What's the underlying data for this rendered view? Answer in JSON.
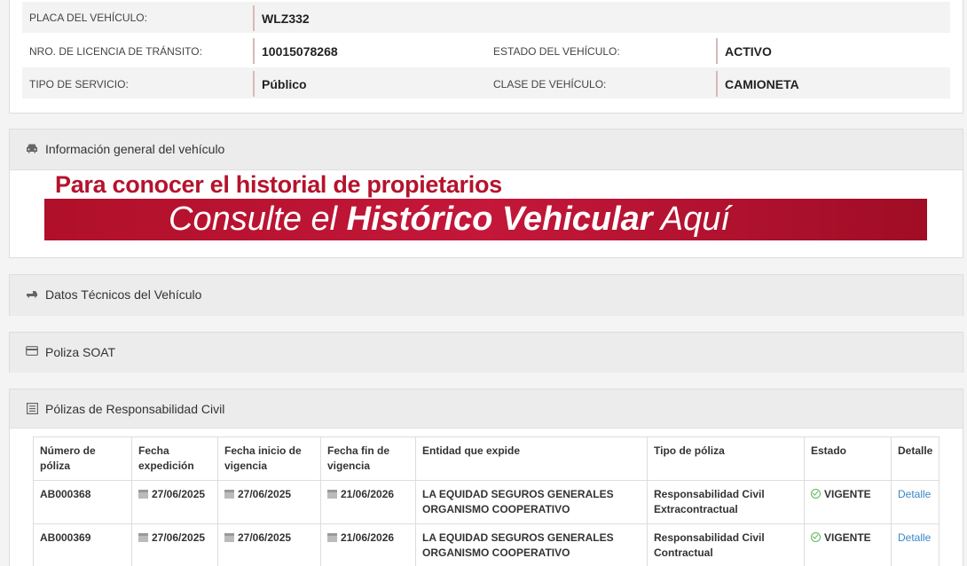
{
  "vehicle": {
    "plate_label": "PLACA DEL VEHÍCULO:",
    "plate_value": "WLZ332",
    "license_label": "NRO. DE LICENCIA DE TRÁNSITO:",
    "license_value": "10015078268",
    "status_label": "ESTADO DEL VEHÍCULO:",
    "status_value": "ACTIVO",
    "service_label": "TIPO DE SERVICIO:",
    "service_value": "Público",
    "class_label": "CLASE DE VEHÍCULO:",
    "class_value": "CAMIONETA"
  },
  "sections": {
    "general": "Información general del vehículo",
    "technical": "Datos Técnicos del Vehículo",
    "soat": "Poliza SOAT",
    "civil": "Pólizas de Responsabilidad Civil"
  },
  "banner": {
    "line1": "Para conocer el historial de propietarios",
    "line2_a": "Consulte el ",
    "line2_b": "Histórico Vehicular",
    "line2_c": " Aquí"
  },
  "table": {
    "headers": [
      "Número de póliza",
      "Fecha expedición",
      "Fecha inicio de vigencia",
      "Fecha fin de vigencia",
      "Entidad que expide",
      "Tipo de póliza",
      "Estado",
      "Detalle"
    ],
    "rows": [
      {
        "number": "AB000368",
        "issued": "27/06/2025",
        "start": "27/06/2025",
        "end": "21/06/2026",
        "entity": "LA EQUIDAD SEGUROS GENERALES ORGANISMO COOPERATIVO",
        "type": "Responsabilidad Civil Extracontractual",
        "status": "VIGENTE",
        "detail": "Detalle"
      },
      {
        "number": "AB000369",
        "issued": "27/06/2025",
        "start": "27/06/2025",
        "end": "21/06/2026",
        "entity": "LA EQUIDAD SEGUROS GENERALES ORGANISMO COOPERATIVO",
        "type": "Responsabilidad Civil Contractual",
        "status": "VIGENTE",
        "detail": "Detalle"
      }
    ]
  },
  "colors": {
    "accent": "#b5132d",
    "link": "#3a87c6",
    "ok": "#5cb85c"
  }
}
